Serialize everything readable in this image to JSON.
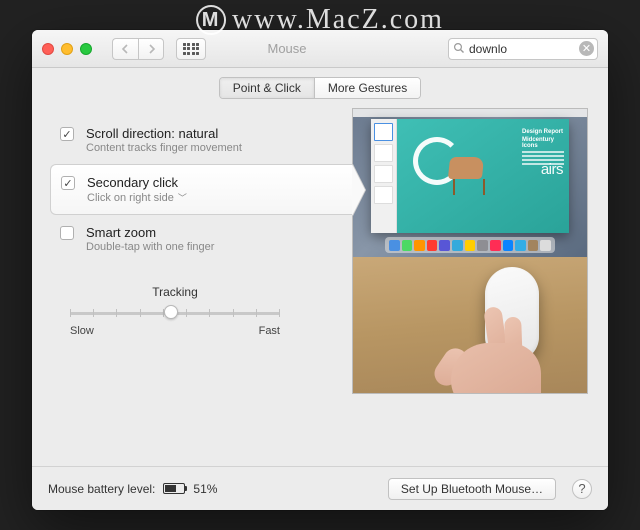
{
  "watermark": "www.MacZ.com",
  "window": {
    "title": "Mouse",
    "search": {
      "value": "downlo"
    },
    "tabs": {
      "point_click": "Point & Click",
      "more_gestures": "More Gestures",
      "active": "point_click"
    },
    "options": {
      "scroll": {
        "label": "Scroll direction: natural",
        "desc": "Content tracks finger movement",
        "checked": true
      },
      "secondary": {
        "label": "Secondary click",
        "desc": "Click on right side",
        "checked": true,
        "selected": true
      },
      "smartzoom": {
        "label": "Smart zoom",
        "desc": "Double-tap with one finger",
        "checked": false
      }
    },
    "tracking": {
      "label": "Tracking",
      "slow": "Slow",
      "fast": "Fast",
      "position_pct": 48
    },
    "preview": {
      "slide_title": "Design Report",
      "slide_subtitle": "Midcentury Icons",
      "slide_word": "airs",
      "dock_colors": [
        "#4a90e2",
        "#4cd964",
        "#ff9500",
        "#ff3b30",
        "#5856d6",
        "#34aadc",
        "#ffcd00",
        "#8e8e93",
        "#ff2d55",
        "#0b84ff",
        "#32ade6",
        "#a2845e",
        "#dcdcdc"
      ]
    },
    "footer": {
      "battery_label": "Mouse battery level:",
      "battery_pct": 51,
      "bluetooth_btn": "Set Up Bluetooth Mouse…"
    }
  }
}
